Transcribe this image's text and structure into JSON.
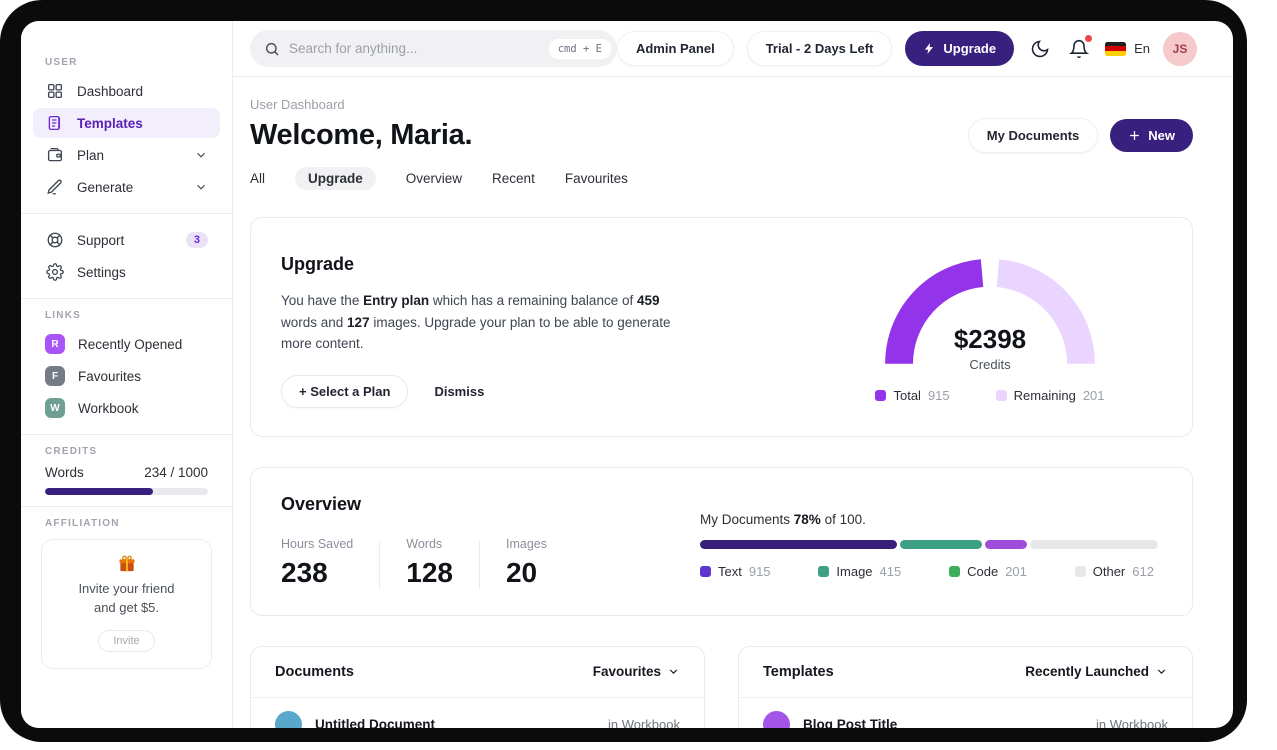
{
  "colors": {
    "brand_dark_purple": "#38217e",
    "accent_purple": "#9333ea",
    "accent_purple_light": "#e9d5ff",
    "active_item_bg": "#f3eefb",
    "active_item_text": "#5b21b6",
    "notification_red": "#ef4444"
  },
  "icons": {
    "search": "magnifier",
    "dashboard": "grid-2x2",
    "templates": "document-lines",
    "plan": "wallet",
    "generate": "pencil",
    "support": "life-buoy",
    "settings": "gear",
    "theme": "crescent-moon",
    "notifications": "bell-with-red-dot",
    "language_flag": "german-flag",
    "upgrade": "lightning-bolt",
    "new": "plus",
    "affiliation": "gift",
    "expand": "chevron-down"
  },
  "topbar": {
    "search": {
      "placeholder": "Search for anything...",
      "shortcut": "cmd + E"
    },
    "admin_panel_label": "Admin Panel",
    "trial_label": "Trial - 2 Days Left",
    "upgrade_label": "Upgrade",
    "language": "En",
    "avatar_initials": "JS"
  },
  "sidebar": {
    "section_user": "USER",
    "section_links": "LINKS",
    "section_credits": "CREDITS",
    "section_affiliation": "AFFILIATION",
    "items": {
      "dashboard": "Dashboard",
      "templates": "Templates",
      "plan": "Plan",
      "generate": "Generate",
      "support": "Support",
      "support_badge": "3",
      "settings": "Settings"
    },
    "links": [
      {
        "initial": "R",
        "label": "Recently Opened",
        "color": "#a855f7"
      },
      {
        "initial": "F",
        "label": "Favourites",
        "color": "#767c85"
      },
      {
        "initial": "W",
        "label": "Workbook",
        "color": "#6f9e92"
      }
    ],
    "credits": {
      "label": "Words",
      "value": "234 / 1000",
      "fill_width": "66%",
      "fill_color": "#38217e"
    },
    "affiliation": {
      "line1": "Invite your friend",
      "line2": "and get $5.",
      "button_label": "Invite"
    }
  },
  "header": {
    "breadcrumb": "User Dashboard",
    "title": "Welcome, Maria.",
    "my_documents_label": "My Documents",
    "new_label": "New"
  },
  "tabs": [
    {
      "label": "All"
    },
    {
      "label": "Upgrade",
      "active": true
    },
    {
      "label": "Overview"
    },
    {
      "label": "Recent"
    },
    {
      "label": "Favourites"
    }
  ],
  "upgrade_card": {
    "title": "Upgrade",
    "body": {
      "t1": "You have the ",
      "b1": "Entry plan",
      "t2": " which has a remaining balance of ",
      "b2": "459",
      "t3": " words and ",
      "b3": "127",
      "t4": " images. Upgrade your plan to be able to generate more content."
    },
    "select_plan_label": "Select a Plan",
    "dismiss_label": "Dismiss",
    "gauge": {
      "amount": "$2398",
      "caption": "Credits",
      "total_label": "Total",
      "total_value": "915",
      "total_color": "#9333ea",
      "remaining_label": "Remaining",
      "remaining_value": "201",
      "remaining_color": "#e9d5ff"
    }
  },
  "overview_card": {
    "title": "Overview",
    "stats": [
      {
        "label": "Hours Saved",
        "value": "238"
      },
      {
        "label": "Words",
        "value": "128"
      },
      {
        "label": "Images",
        "value": "20"
      }
    ],
    "progress": {
      "prefix": "My Documents ",
      "percent": "78%",
      "suffix": " of 100.",
      "segments": [
        {
          "label": "Text",
          "value": "915",
          "bar_color": "#371f7a",
          "legend_color": "#5f35cf",
          "width": "43%"
        },
        {
          "label": "Image",
          "value": "415",
          "bar_color": "#3ea183",
          "legend_color": "#3ea183",
          "width": "18%"
        },
        {
          "label": "Code",
          "value": "201",
          "bar_color": "#9f4bdb",
          "legend_color": "#3fae5a",
          "width": "9%"
        },
        {
          "label": "Other",
          "value": "612",
          "bar_color": "#e7e7ea",
          "legend_color": "#e7e7ea",
          "width": ""
        }
      ]
    }
  },
  "documents_card": {
    "title": "Documents",
    "filter_label": "Favourites",
    "rows": [
      {
        "title": "Untitled Document",
        "location": "in Workbook",
        "avatar_color": "#5aa7cc"
      }
    ]
  },
  "templates_card": {
    "title": "Templates",
    "filter_label": "Recently Launched",
    "rows": [
      {
        "title": "Blog Post Title",
        "location": "in Workbook",
        "avatar_color": "#a554e8"
      }
    ]
  }
}
